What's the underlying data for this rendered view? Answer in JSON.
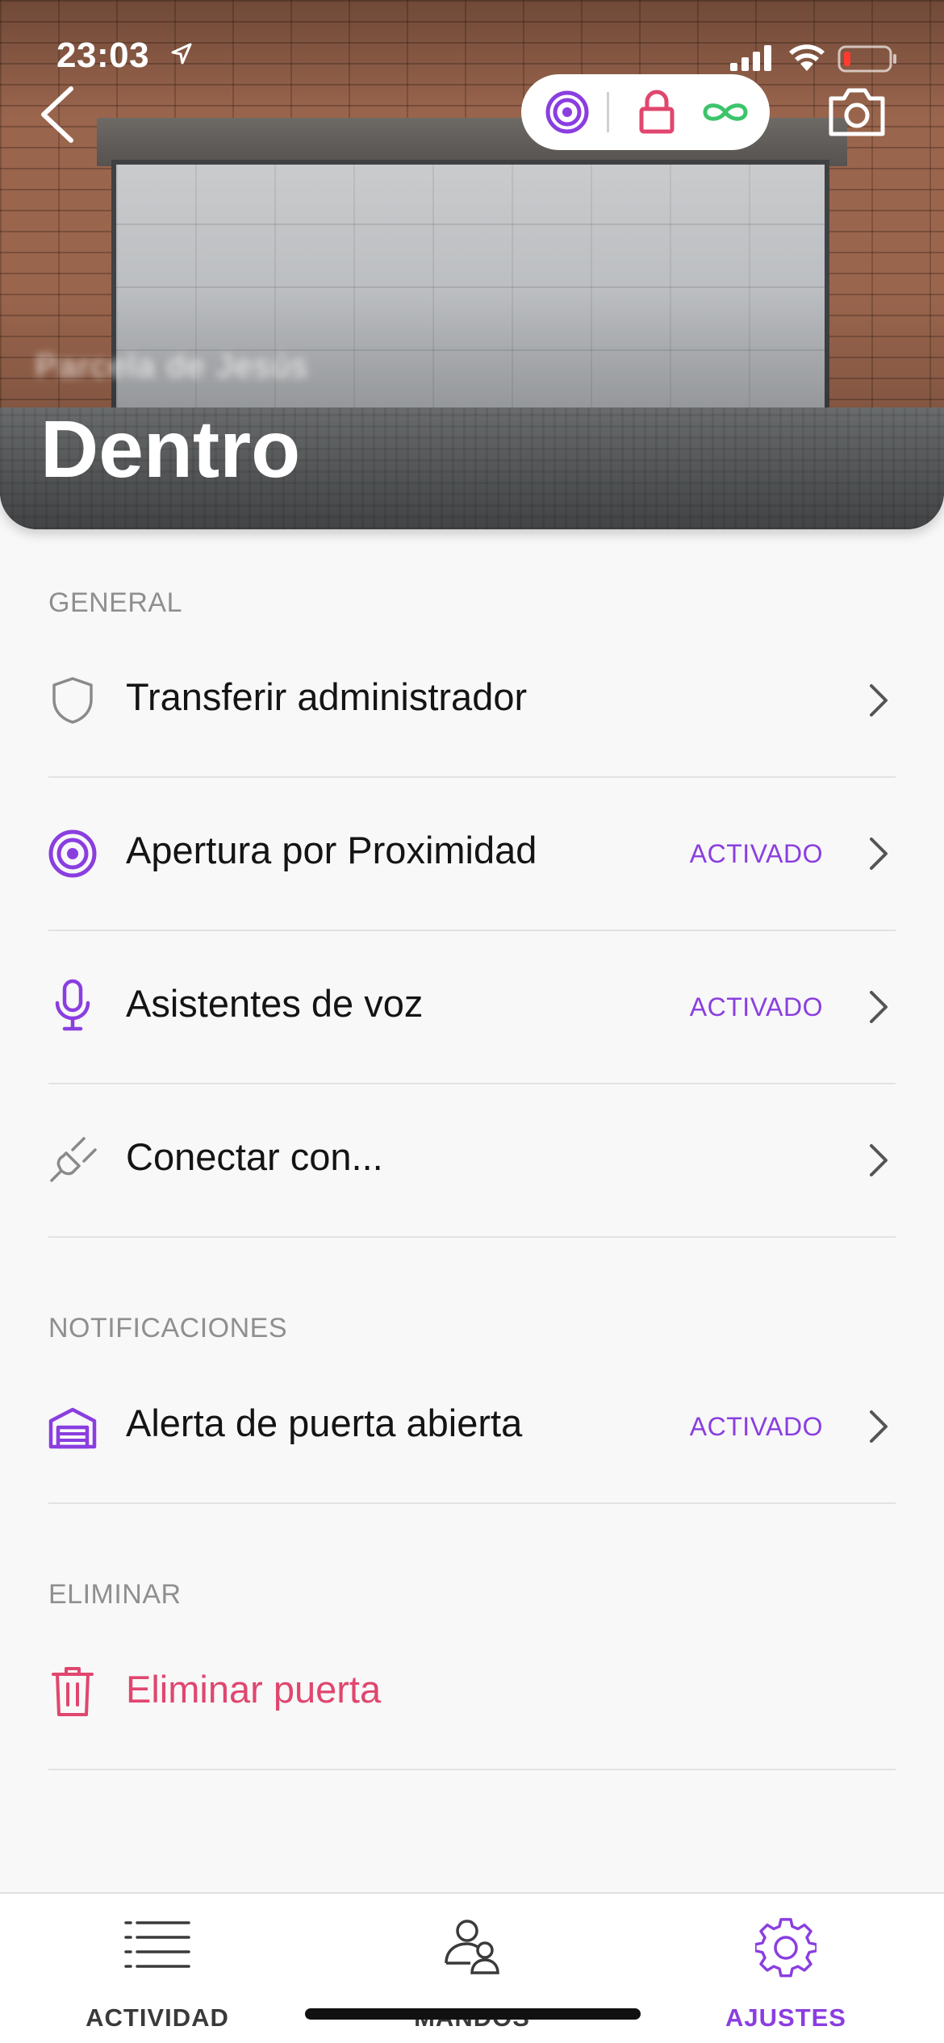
{
  "status_bar": {
    "time": "23:03"
  },
  "hero": {
    "subtitle": "Parcela de Jesús",
    "title": "Dentro",
    "icons": {
      "back": "chevron-left-icon",
      "proximity": "target-icon",
      "lock": "lock-icon",
      "infinite": "infinity-icon",
      "camera": "camera-icon"
    }
  },
  "sections": {
    "general": {
      "title": "GENERAL",
      "items": [
        {
          "label": "Transferir administrador",
          "value": "",
          "icon": "shield-icon"
        },
        {
          "label": "Apertura por Proximidad",
          "value": "ACTIVADO",
          "icon": "target-icon"
        },
        {
          "label": "Asistentes de voz",
          "value": "ACTIVADO",
          "icon": "microphone-icon"
        },
        {
          "label": "Conectar con...",
          "value": "",
          "icon": "plug-icon"
        }
      ]
    },
    "notificaciones": {
      "title": "NOTIFICACIONES",
      "items": [
        {
          "label": "Alerta de puerta abierta",
          "value": "ACTIVADO",
          "icon": "garage-icon"
        }
      ]
    },
    "eliminar": {
      "title": "ELIMINAR",
      "items": [
        {
          "label": "Eliminar puerta",
          "icon": "trash-icon"
        }
      ]
    }
  },
  "tabbar": {
    "tabs": [
      {
        "label": "ACTIVIDAD",
        "icon": "list-icon"
      },
      {
        "label": "MANDOS",
        "icon": "users-icon"
      },
      {
        "label": "AJUSTES",
        "icon": "gear-icon"
      }
    ],
    "active": "AJUSTES"
  },
  "colors": {
    "accent": "#8a3ee0",
    "danger": "#e0466e",
    "success": "#3cc46a",
    "background": "#f8f8f8"
  }
}
